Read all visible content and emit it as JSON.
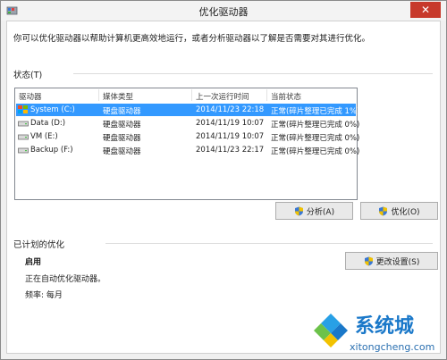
{
  "window": {
    "title": "优化驱动器",
    "close_glyph": "✕"
  },
  "description": "你可以优化驱动器以帮助计算机更高效地运行，或者分析驱动器以了解是否需要对其进行优化。",
  "status": {
    "label": "状态(T)",
    "columns": [
      "驱动器",
      "媒体类型",
      "上一次运行时间",
      "当前状态"
    ],
    "drives": [
      {
        "name": "System (C:)",
        "media": "硬盘驱动器",
        "last_run": "2014/11/23 22:18",
        "status": "正常(碎片整理已完成 1%)",
        "icon": "windows-drive-icon",
        "selected": true
      },
      {
        "name": "Data (D:)",
        "media": "硬盘驱动器",
        "last_run": "2014/11/19 10:07",
        "status": "正常(碎片整理已完成 0%)",
        "icon": "hard-drive-icon",
        "selected": false
      },
      {
        "name": "VM (E:)",
        "media": "硬盘驱动器",
        "last_run": "2014/11/19 10:07",
        "status": "正常(碎片整理已完成 0%)",
        "icon": "hard-drive-icon",
        "selected": false
      },
      {
        "name": "Backup (F:)",
        "media": "硬盘驱动器",
        "last_run": "2014/11/23 22:17",
        "status": "正常(碎片整理已完成 0%)",
        "icon": "hard-drive-icon",
        "selected": false
      }
    ]
  },
  "buttons": {
    "analyze": "分析(A)",
    "optimize": "优化(O)",
    "change_settings": "更改设置(S)"
  },
  "schedule": {
    "label": "已计划的优化",
    "state": "启用",
    "detail": "正在自动优化驱动器。",
    "frequency": "频率: 每月"
  },
  "watermark": {
    "brand": "系统城",
    "url": "xitongcheng.com"
  },
  "colors": {
    "selection": "#3399ff",
    "close": "#c7392b",
    "watermark_blue": "#1a78c9"
  }
}
